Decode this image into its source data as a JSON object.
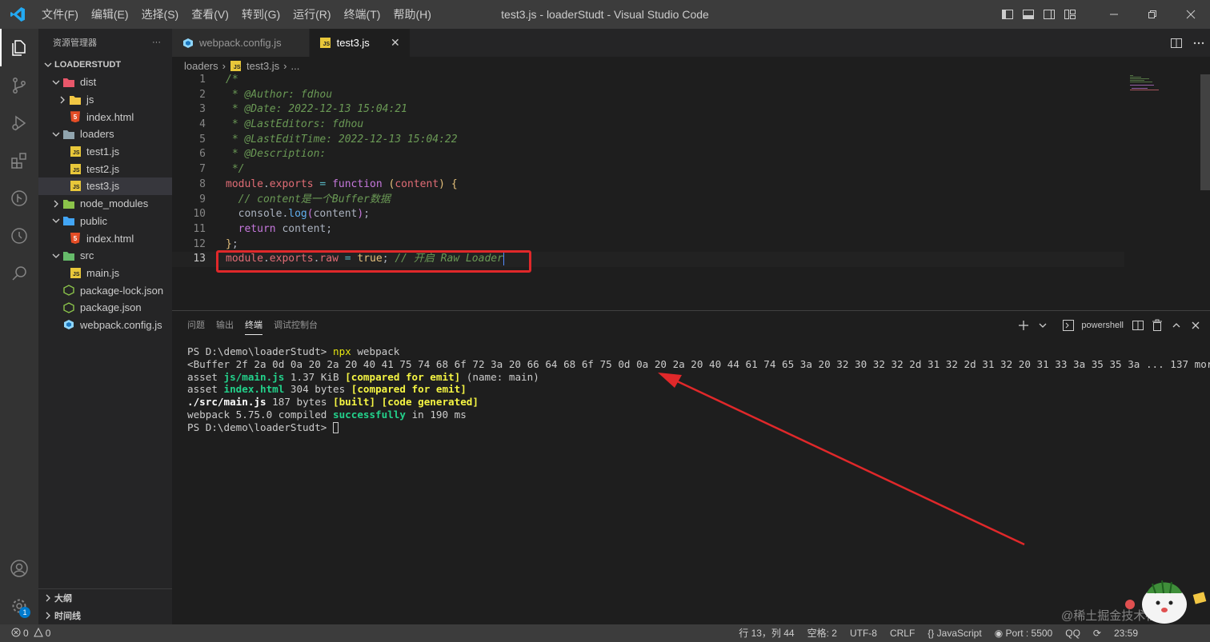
{
  "titlebar": {
    "menu": [
      "文件(F)",
      "编辑(E)",
      "选择(S)",
      "查看(V)",
      "转到(G)",
      "运行(R)",
      "终端(T)",
      "帮助(H)"
    ],
    "window_title": "test3.js - loaderStudt - Visual Studio Code"
  },
  "sidebar": {
    "header": "资源管理器",
    "more": "···",
    "root": "LOADERSTUDT",
    "tree": [
      {
        "label": "dist",
        "type": "folder-open",
        "icon": "folder-dist-icon"
      },
      {
        "label": "js",
        "type": "folder-closed",
        "icon": "folder-js-icon"
      },
      {
        "label": "index.html",
        "type": "file",
        "icon": "html-file-icon"
      },
      {
        "label": "loaders",
        "type": "folder-open",
        "icon": "folder-icon"
      },
      {
        "label": "test1.js",
        "type": "file",
        "icon": "js-file-icon"
      },
      {
        "label": "test2.js",
        "type": "file",
        "icon": "js-file-icon"
      },
      {
        "label": "test3.js",
        "type": "file",
        "icon": "js-file-icon"
      },
      {
        "label": "node_modules",
        "type": "folder-closed",
        "icon": "folder-node-icon"
      },
      {
        "label": "public",
        "type": "folder-open",
        "icon": "folder-public-icon"
      },
      {
        "label": "index.html",
        "type": "file",
        "icon": "html-file-icon"
      },
      {
        "label": "src",
        "type": "folder-open",
        "icon": "folder-src-icon"
      },
      {
        "label": "main.js",
        "type": "file",
        "icon": "js-file-icon"
      },
      {
        "label": "package-lock.json",
        "type": "file",
        "icon": "npm-file-icon"
      },
      {
        "label": "package.json",
        "type": "file",
        "icon": "npm-file-icon"
      },
      {
        "label": "webpack.config.js",
        "type": "file",
        "icon": "webpack-icon"
      }
    ],
    "outline": "大纲",
    "timeline": "时间线"
  },
  "tabs": [
    {
      "label": "webpack.config.js",
      "active": false
    },
    {
      "label": "test3.js",
      "active": true
    }
  ],
  "tab_close": "✕",
  "breadcrumb": {
    "folder": "loaders",
    "file": "test3.js",
    "more": "..."
  },
  "code": {
    "line_numbers": [
      "1",
      "2",
      "3",
      "4",
      "5",
      "6",
      "7",
      "8",
      "9",
      "10",
      "11",
      "12",
      "13"
    ],
    "l1": "/*",
    "l2": " * @Author: fdhou",
    "l3": " * @Date: 2022-12-13 15:04:21",
    "l4": " * @LastEditors: fdhou",
    "l5": " * @LastEditTime: 2022-12-13 15:04:22",
    "l6": " * @Description:",
    "l7": " */",
    "module": "module",
    "exports": "exports",
    "function": "function",
    "content": "content",
    "l9_comment": "// content是一个Buffer数据",
    "console": "console",
    "log": "log",
    "return": "return",
    "raw": "raw",
    "true": "true",
    "l13_comment": "// 开启 Raw Loader"
  },
  "panel": {
    "tabs": [
      "问题",
      "输出",
      "终端",
      "调试控制台"
    ],
    "active_tab": "终端",
    "shell": "powershell",
    "terminal": {
      "l1_prompt": "PS D:\\demo\\loaderStudt> ",
      "l1_cmd": "npx",
      "l1_arg": " webpack",
      "l2": "<Buffer 2f 2a 0d 0a 20 2a 20 40 41 75 74 68 6f 72 3a 20 66 64 68 6f 75 0d 0a 20 2a 20 40 44 61 74 65 3a 20 32 30 32 32 2d 31 32 2d 31 33 20 31 35 3a 30 34 3a 32 31 0d 0a 20 2a 20 40 4c 61 73 74 45 64 69 74 6f 72 73 3a 20 66 64 68 6f 75 0d 0a 20 2a 20 40 4c 61 73 74 45 64 69 74 54 69 6d 65 3a 20 32 30 32 32 2d 31 32 2d 31 33 20 31 35 3a 30 34 3a 32 32 0d 0a 20 2a 20 40 44 65 73 63 72 69 70 74 69 6f 6e 3a 20 0d 0a 20 2a 2f 0d 0a 6d 6f 64 75 6c 65 ... 137 more bytes>",
      "l2_visible": "<Buffer 2f 2a 0d 0a 20 2a 20 40 41 75 74 68 6f 72 3a 20 66 64 68 6f 75 0d 0a 20 2a 20 40 44 61 74 65 3a 20 32 30 32 32 2d 31 32 2d 31 32 20 31 33 3a 35 35 3a ... 137 more bytes>",
      "l3_a": "asset ",
      "l3_file": "js/main.js",
      "l3_size": " 1.37 KiB ",
      "l3_tag": "[compared for emit]",
      "l3_rest": " (name: main)",
      "l4_a": "asset ",
      "l4_file": "index.html",
      "l4_size": " 304 bytes ",
      "l4_tag": "[compared for emit]",
      "l5_file": "./src/main.js",
      "l5_size": " 187 bytes ",
      "l5_tag": "[built] [code generated]",
      "l6_a": "webpack 5.75.0 compiled ",
      "l6_ok": "successfully",
      "l6_rest": " in 190 ms",
      "l7_prompt": "PS D:\\demo\\loaderStudt> "
    }
  },
  "statusbar": {
    "errors": "0",
    "warnings": "0",
    "position": "行 13，列 44",
    "spaces": "空格: 2",
    "encoding": "UTF-8",
    "eol": "CRLF",
    "language": "JavaScript",
    "language_prefix": "{}",
    "port": "Port : 5500",
    "qq": "QQ",
    "time": "23:59"
  },
  "watermark": "@稀土掘金技术社区",
  "colors": {
    "accent": "#007acc",
    "highlight_box": "#e0282a",
    "arrow": "#e0282a"
  }
}
